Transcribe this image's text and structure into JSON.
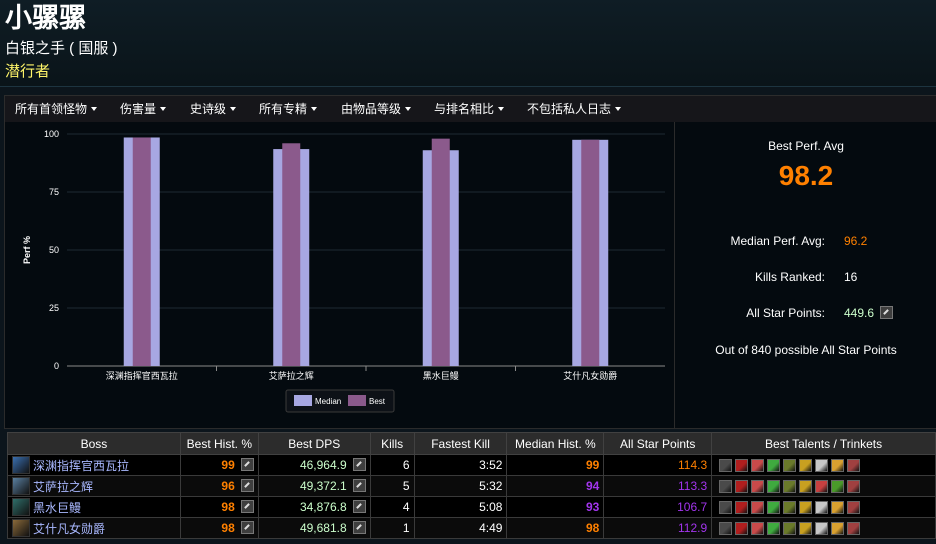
{
  "character": {
    "name": "小骡骡",
    "server": "白银之手 ( 国服 )",
    "spec": "潜行者"
  },
  "filters": [
    "所有首领怪物",
    "伤害量",
    "史诗级",
    "所有专精",
    "由物品等级",
    "与排名相比",
    "不包括私人日志"
  ],
  "chart_data": {
    "type": "bar",
    "categories": [
      "深渊指挥官西瓦拉",
      "艾萨拉之辉",
      "黑水巨鳗",
      "艾什凡女勋爵"
    ],
    "series": [
      {
        "name": "Median",
        "values": [
          98.5,
          93.5,
          93,
          97.5
        ],
        "color": "#a7a7e2"
      },
      {
        "name": "Best",
        "values": [
          98.5,
          96,
          98,
          97.5
        ],
        "color": "#8b5a8c"
      }
    ],
    "ylabel": "Perf %",
    "ylim": [
      0,
      100
    ],
    "yticks": [
      0,
      25,
      50,
      75,
      100
    ],
    "grid": true,
    "legend": "bottom-center"
  },
  "stats": {
    "best_perf_label": "Best Perf. Avg",
    "best_perf_value": "98.2",
    "median_label": "Median Perf. Avg:",
    "median_value": "96.2",
    "kills_label": "Kills Ranked:",
    "kills_value": "16",
    "asp_label": "All Star Points:",
    "asp_value": "449.6",
    "note": "Out of 840 possible All Star Points"
  },
  "table": {
    "headers": [
      "Boss",
      "Best Hist. %",
      "Best DPS",
      "Kills",
      "Fastest Kill",
      "Median Hist. %",
      "All Star Points",
      "Best Talents / Trinkets"
    ],
    "rows": [
      {
        "boss": "深渊指挥官西瓦拉",
        "boss_color": "#3a6fb0",
        "best_hist": "99",
        "best_hist_color": "#ff8000",
        "best_dps": "46,964.9",
        "kills": "6",
        "fastest": "3:52",
        "median_hist": "99",
        "median_color": "#ff8000",
        "asp": "114.3",
        "asp_color": "#ff8000"
      },
      {
        "boss": "艾萨拉之辉",
        "boss_color": "#5a7fa0",
        "best_hist": "96",
        "best_hist_color": "#ff8000",
        "best_dps": "49,372.1",
        "kills": "5",
        "fastest": "5:32",
        "median_hist": "94",
        "median_color": "#a335ee",
        "asp": "113.3",
        "asp_color": "#a335ee"
      },
      {
        "boss": "黑水巨鳗",
        "boss_color": "#2f6e6a",
        "best_hist": "98",
        "best_hist_color": "#ff8000",
        "best_dps": "34,876.8",
        "kills": "4",
        "fastest": "5:08",
        "median_hist": "93",
        "median_color": "#a335ee",
        "asp": "106.7",
        "asp_color": "#a335ee"
      },
      {
        "boss": "艾什凡女勋爵",
        "boss_color": "#8a6a3a",
        "best_hist": "98",
        "best_hist_color": "#ff8000",
        "best_dps": "49,681.8",
        "kills": "1",
        "fastest": "4:49",
        "median_hist": "98",
        "median_color": "#ff8000",
        "asp": "112.9",
        "asp_color": "#a335ee"
      }
    ],
    "talent_icon_colors": [
      [
        "#4a4a4a",
        "#b01e1e",
        "#c84a4a",
        "#3faa3f",
        "#6a7a2a",
        "#c8a020",
        "#c8c8c8",
        "#d8a030",
        "#a04040"
      ],
      [
        "#4a4a4a",
        "#b01e1e",
        "#c84a4a",
        "#3faa3f",
        "#6a7a2a",
        "#c8a020",
        "#c84040",
        "#4a9a2a",
        "#a04040"
      ],
      [
        "#4a4a4a",
        "#b01e1e",
        "#c84a4a",
        "#3faa3f",
        "#6a7a2a",
        "#c8a020",
        "#c8c8c8",
        "#d8a030",
        "#a04040"
      ],
      [
        "#4a4a4a",
        "#b01e1e",
        "#c84a4a",
        "#3faa3f",
        "#6a7a2a",
        "#c8a020",
        "#c8c8c8",
        "#d8a030",
        "#a04040"
      ]
    ]
  }
}
